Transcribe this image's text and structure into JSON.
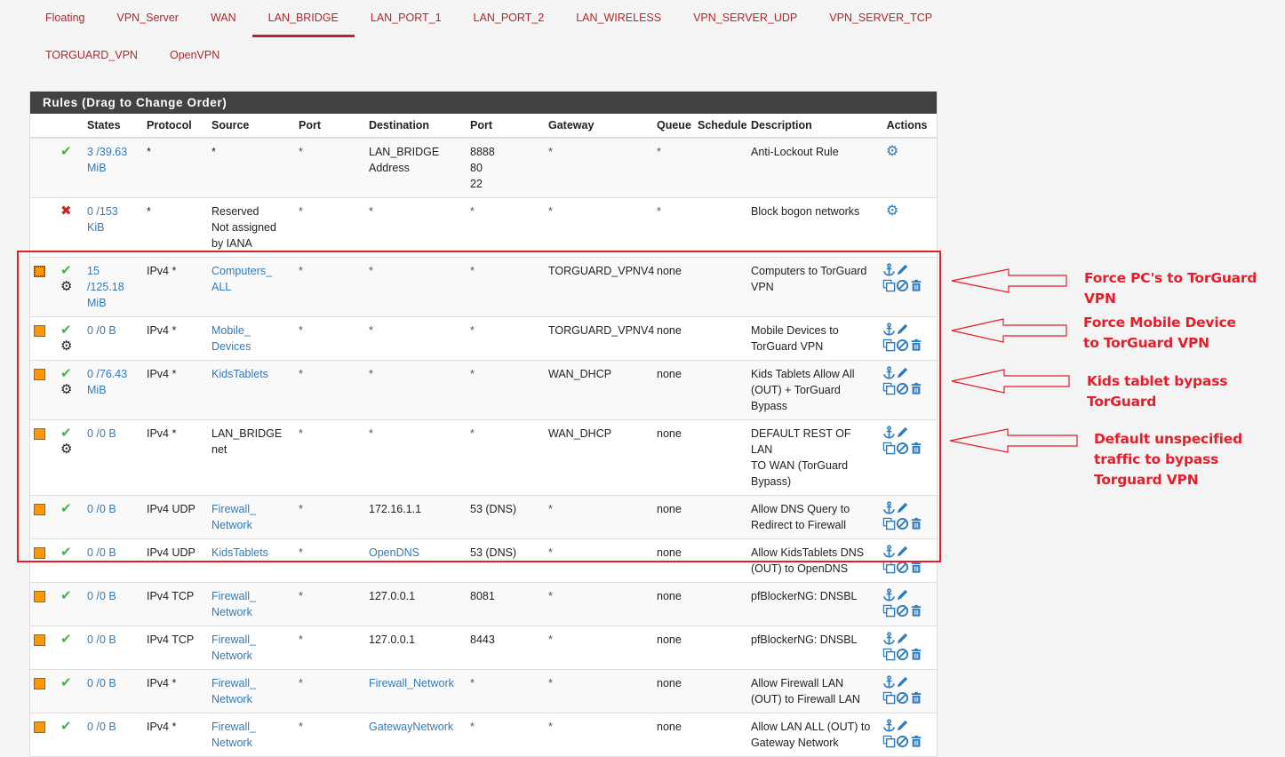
{
  "tabs": {
    "row1": [
      "Floating",
      "VPN_Server",
      "WAN",
      "LAN_BRIDGE",
      "LAN_PORT_1",
      "LAN_PORT_2",
      "LAN_WIRELESS",
      "VPN_SERVER_UDP",
      "VPN_SERVER_TCP"
    ],
    "row2": [
      "TORGUARD_VPN",
      "OpenVPN"
    ],
    "active": "LAN_BRIDGE"
  },
  "panel": {
    "title": "Rules (Drag to Change Order)",
    "columns": [
      "",
      "",
      "States",
      "Protocol",
      "Source",
      "Port",
      "Destination",
      "Port",
      "Gateway",
      "Queue",
      "Schedule",
      "Description",
      "Actions"
    ]
  },
  "rules": [
    {
      "checkbox": false,
      "status": "pass",
      "advanced": false,
      "states": [
        "3 /39.63",
        "MiB"
      ],
      "protocol": "*",
      "source": [
        "*"
      ],
      "source_link": false,
      "sport": "*",
      "destination": [
        "LAN_BRIDGE",
        "Address"
      ],
      "dest_link": false,
      "dport": [
        "8888",
        "80",
        "22"
      ],
      "gateway": "*",
      "queue": "*",
      "schedule": "",
      "description": [
        "Anti-Lockout Rule"
      ],
      "actions": "gear"
    },
    {
      "checkbox": false,
      "status": "block",
      "advanced": false,
      "states": [
        "0 /153",
        "KiB"
      ],
      "protocol": "*",
      "source": [
        "Reserved",
        "Not assigned",
        "by IANA"
      ],
      "source_link": false,
      "sport": "*",
      "destination": [
        "*"
      ],
      "dest_link": false,
      "dport": [
        "*"
      ],
      "gateway": "*",
      "queue": "*",
      "schedule": "",
      "description": [
        "Block bogon networks"
      ],
      "actions": "gear"
    },
    {
      "checkbox": true,
      "focused": true,
      "status": "pass",
      "advanced": true,
      "states": [
        "15",
        "/125.18",
        "MiB"
      ],
      "protocol": "IPv4 *",
      "source": [
        "Computers_",
        "ALL"
      ],
      "source_link": true,
      "sport": "*",
      "destination": [
        "*"
      ],
      "dest_link": false,
      "dport": [
        "*"
      ],
      "gateway": "TORGUARD_VPNV4",
      "queue": "none",
      "schedule": "",
      "description": [
        "Computers to TorGuard",
        "VPN"
      ],
      "actions": "full"
    },
    {
      "checkbox": true,
      "status": "pass",
      "advanced": true,
      "states": [
        "0 /0 B"
      ],
      "protocol": "IPv4 *",
      "source": [
        "Mobile_",
        "Devices"
      ],
      "source_link": true,
      "sport": "*",
      "destination": [
        "*"
      ],
      "dest_link": false,
      "dport": [
        "*"
      ],
      "gateway": "TORGUARD_VPNV4",
      "queue": "none",
      "schedule": "",
      "description": [
        "Mobile Devices to",
        "TorGuard VPN"
      ],
      "actions": "full"
    },
    {
      "checkbox": true,
      "status": "pass",
      "advanced": true,
      "states": [
        "0 /76.43",
        "MiB"
      ],
      "protocol": "IPv4 *",
      "source": [
        "KidsTablets"
      ],
      "source_link": true,
      "sport": "*",
      "destination": [
        "*"
      ],
      "dest_link": false,
      "dport": [
        "*"
      ],
      "gateway": "WAN_DHCP",
      "queue": "none",
      "schedule": "",
      "description": [
        "Kids Tablets Allow All",
        "(OUT) + TorGuard",
        "Bypass"
      ],
      "actions": "full"
    },
    {
      "checkbox": true,
      "status": "pass",
      "advanced": true,
      "states": [
        "0 /0 B"
      ],
      "protocol": "IPv4 *",
      "source": [
        "LAN_BRIDGE",
        "net"
      ],
      "source_link": false,
      "sport": "*",
      "destination": [
        "*"
      ],
      "dest_link": false,
      "dport": [
        "*"
      ],
      "gateway": "WAN_DHCP",
      "queue": "none",
      "schedule": "",
      "description": [
        "DEFAULT REST OF LAN",
        "TO WAN (TorGuard",
        "Bypass)"
      ],
      "actions": "full"
    },
    {
      "checkbox": true,
      "status": "pass",
      "advanced": false,
      "states": [
        "0 /0 B"
      ],
      "protocol": "IPv4 UDP",
      "source": [
        "Firewall_",
        "Network"
      ],
      "source_link": true,
      "sport": "*",
      "destination": [
        "172.16.1.1"
      ],
      "dest_link": false,
      "dport": [
        "53 (DNS)"
      ],
      "gateway": "*",
      "queue": "none",
      "schedule": "",
      "description": [
        "Allow DNS Query to",
        "Redirect to Firewall"
      ],
      "actions": "full"
    },
    {
      "checkbox": true,
      "status": "pass",
      "advanced": false,
      "states": [
        "0 /0 B"
      ],
      "protocol": "IPv4 UDP",
      "source": [
        "KidsTablets"
      ],
      "source_link": true,
      "sport": "*",
      "destination": [
        "OpenDNS"
      ],
      "dest_link": true,
      "dport": [
        "53 (DNS)"
      ],
      "gateway": "*",
      "queue": "none",
      "schedule": "",
      "description": [
        "Allow KidsTablets DNS",
        "(OUT) to OpenDNS"
      ],
      "actions": "full"
    },
    {
      "checkbox": true,
      "status": "pass",
      "advanced": false,
      "states": [
        "0 /0 B"
      ],
      "protocol": "IPv4 TCP",
      "source": [
        "Firewall_",
        "Network"
      ],
      "source_link": true,
      "sport": "*",
      "destination": [
        "127.0.0.1"
      ],
      "dest_link": false,
      "dport": [
        "8081"
      ],
      "gateway": "*",
      "queue": "none",
      "schedule": "",
      "description": [
        "pfBlockerNG: DNSBL"
      ],
      "actions": "full"
    },
    {
      "checkbox": true,
      "status": "pass",
      "advanced": false,
      "states": [
        "0 /0 B"
      ],
      "protocol": "IPv4 TCP",
      "source": [
        "Firewall_",
        "Network"
      ],
      "source_link": true,
      "sport": "*",
      "destination": [
        "127.0.0.1"
      ],
      "dest_link": false,
      "dport": [
        "8443"
      ],
      "gateway": "*",
      "queue": "none",
      "schedule": "",
      "description": [
        "pfBlockerNG: DNSBL"
      ],
      "actions": "full"
    },
    {
      "checkbox": true,
      "status": "pass",
      "advanced": false,
      "states": [
        "0 /0 B"
      ],
      "protocol": "IPv4 *",
      "source": [
        "Firewall_",
        "Network"
      ],
      "source_link": true,
      "sport": "*",
      "destination": [
        "Firewall_Network"
      ],
      "dest_link": true,
      "dport": [
        "*"
      ],
      "gateway": "*",
      "queue": "none",
      "schedule": "",
      "description": [
        "Allow Firewall LAN",
        "(OUT) to Firewall LAN"
      ],
      "actions": "full"
    },
    {
      "checkbox": true,
      "status": "pass",
      "advanced": false,
      "states": [
        "0 /0 B"
      ],
      "protocol": "IPv4 *",
      "source": [
        "Firewall_",
        "Network"
      ],
      "source_link": true,
      "sport": "*",
      "destination": [
        "GatewayNetwork"
      ],
      "dest_link": true,
      "dport": [
        "*"
      ],
      "gateway": "*",
      "queue": "none",
      "schedule": "",
      "description": [
        "Allow LAN ALL (OUT) to",
        "Gateway Network"
      ],
      "actions": "full"
    }
  ],
  "annotations": [
    {
      "lines": [
        "Force PC's to TorGuard VPN"
      ]
    },
    {
      "lines": [
        "Force Mobile Device",
        "to TorGuard VPN"
      ]
    },
    {
      "lines": [
        "Kids tablet bypass",
        "TorGuard"
      ]
    },
    {
      "lines": [
        "Default unspecified",
        "traffic to bypass",
        "Torguard VPN"
      ]
    }
  ],
  "colors": {
    "accent": "#b3272a",
    "link": "#337ab7",
    "pass": "#4caf50",
    "block": "#c62828",
    "annotation": "#e41e2a",
    "header": "#424242",
    "checkbox": "#ff9800"
  }
}
